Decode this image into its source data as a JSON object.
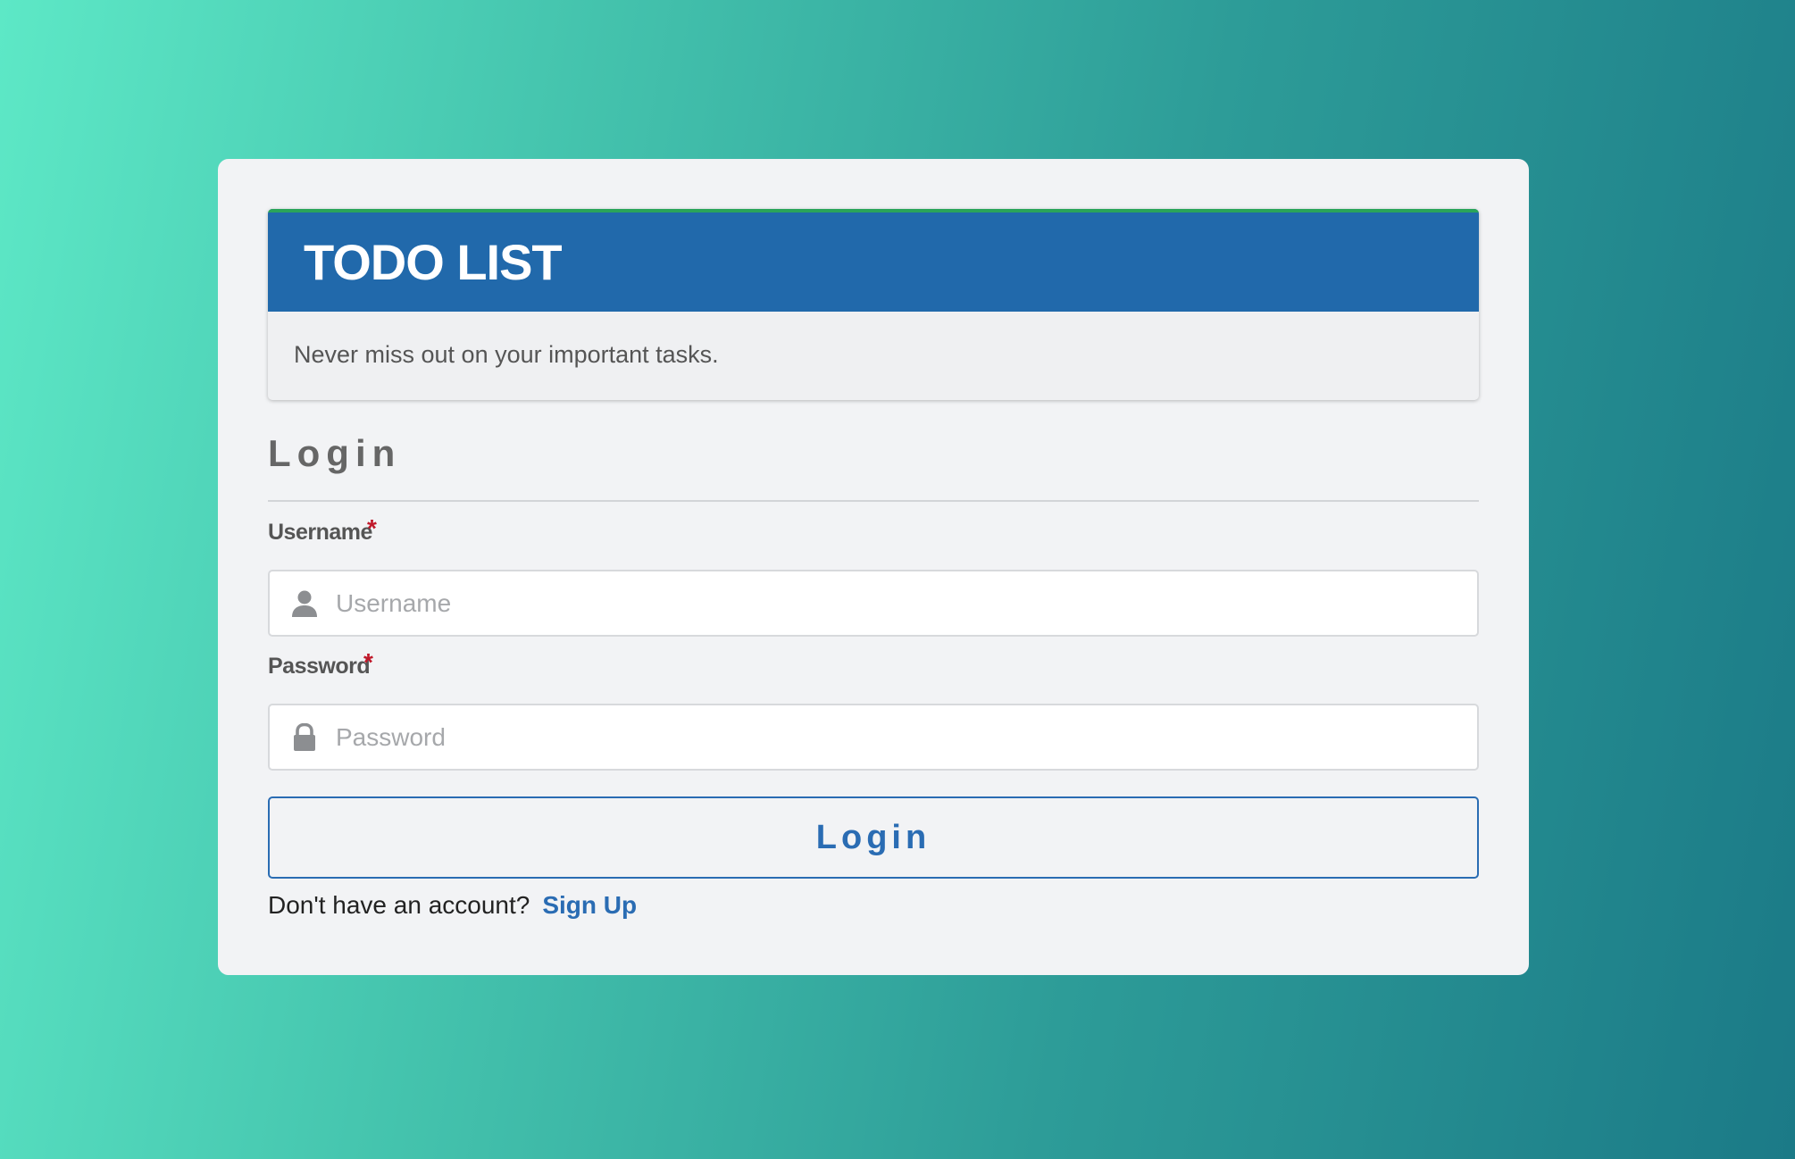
{
  "header": {
    "title": "TODO LIST",
    "subtitle": "Never miss out on your important tasks."
  },
  "login_section": {
    "title": "Login"
  },
  "form": {
    "username": {
      "label": "Username",
      "required_marker": "*",
      "placeholder": "Username",
      "value": "",
      "icon": "user-icon"
    },
    "password": {
      "label": "Password",
      "required_marker": "*",
      "placeholder": "Password",
      "value": "",
      "icon": "lock-icon"
    },
    "submit_label": "Login"
  },
  "signup": {
    "prompt": "Don't have an account?",
    "link_label": "Sign Up"
  },
  "colors": {
    "header_bg": "#2169ab",
    "header_accent": "#2aa45a",
    "primary": "#2a6cb3",
    "required": "#c0182a",
    "gradient_start": "#5de8c6",
    "gradient_end": "#1b7a87"
  }
}
